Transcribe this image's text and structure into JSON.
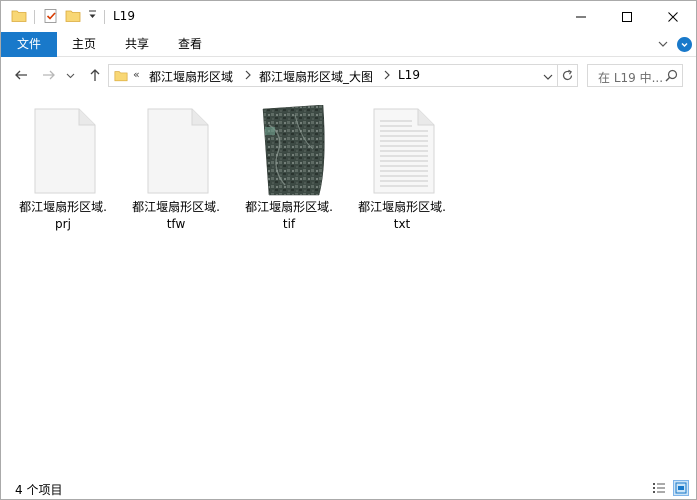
{
  "window": {
    "title": "L19"
  },
  "ribbon": {
    "tab_file": "文件",
    "tab_home": "主页",
    "tab_share": "共享",
    "tab_view": "查看"
  },
  "address": {
    "overflow": "«",
    "crumbs": [
      "都江堰扇形区域",
      "都江堰扇形区域_大图",
      "L19"
    ]
  },
  "search": {
    "placeholder": "在 L19 中..."
  },
  "files": [
    {
      "name": "都江堰扇形区域.",
      "ext": "prj",
      "kind": "blank"
    },
    {
      "name": "都江堰扇形区域.",
      "ext": "tfw",
      "kind": "blank"
    },
    {
      "name": "都江堰扇形区域.",
      "ext": "tif",
      "kind": "image"
    },
    {
      "name": "都江堰扇形区域.",
      "ext": "txt",
      "kind": "text"
    }
  ],
  "status": {
    "count": "4 个项目"
  },
  "colors": {
    "accent": "#1979ca",
    "folder": "#f8d775",
    "border": "#d9d9d9"
  },
  "icons": {
    "title_folder": "folder-icon",
    "properties": "properties-icon",
    "new_folder": "new-folder-icon",
    "back": "back-arrow-icon",
    "forward": "forward-arrow-icon",
    "up": "up-arrow-icon",
    "refresh": "refresh-icon",
    "search": "search-icon"
  }
}
